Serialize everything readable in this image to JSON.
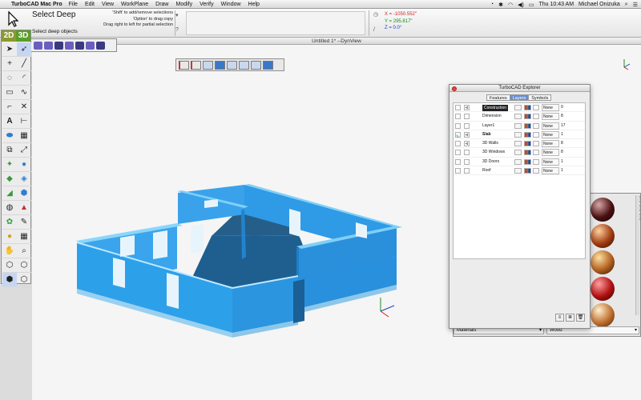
{
  "menubar": {
    "app_name": "TurboCAD Mac Pro",
    "items": [
      "File",
      "Edit",
      "View",
      "WorkPlane",
      "Draw",
      "Modify",
      "Verify",
      "Window",
      "Help"
    ],
    "clock": "Thu 10:43 AM",
    "user": "Michael Onizuka"
  },
  "inspector": {
    "tool_name": "Select Deep",
    "status": "Select deep objects",
    "hints": [
      "'Shift' to add/remove selections",
      "'Option' to drag copy",
      "Drag right to left for partial selection"
    ],
    "help_glyph": "?",
    "coords": {
      "x": "X = -1050.552\"",
      "y": "Y = 295.817\"",
      "z": "Z = 0.0°"
    }
  },
  "palette": {
    "tab_2d": "2D",
    "tab_3d": "3D"
  },
  "window": {
    "title": "Untitled 1* --DynView"
  },
  "explorer": {
    "title": "TurboCAD Explorer",
    "tabs": [
      "Features",
      "Layers",
      "Symbols"
    ],
    "layers": [
      {
        "name": "Construction",
        "linetype": "None",
        "count": "0"
      },
      {
        "name": "Dimension",
        "linetype": "None",
        "count": "8"
      },
      {
        "name": "Layer1",
        "linetype": "None",
        "count": "17"
      },
      {
        "name": "Slab",
        "linetype": "None",
        "count": "1"
      },
      {
        "name": "3D Walls",
        "linetype": "None",
        "count": "8"
      },
      {
        "name": "3D Windows",
        "linetype": "None",
        "count": "8"
      },
      {
        "name": "3D Doors",
        "linetype": "None",
        "count": "1"
      },
      {
        "name": "Roof",
        "linetype": "None",
        "count": "1"
      }
    ]
  },
  "materials": {
    "category": "Materials",
    "library": "Wood"
  },
  "colors": {
    "wall": "#2f9ae6",
    "wall_top": "#6ec4f5",
    "floor": "#1f5f8f"
  }
}
